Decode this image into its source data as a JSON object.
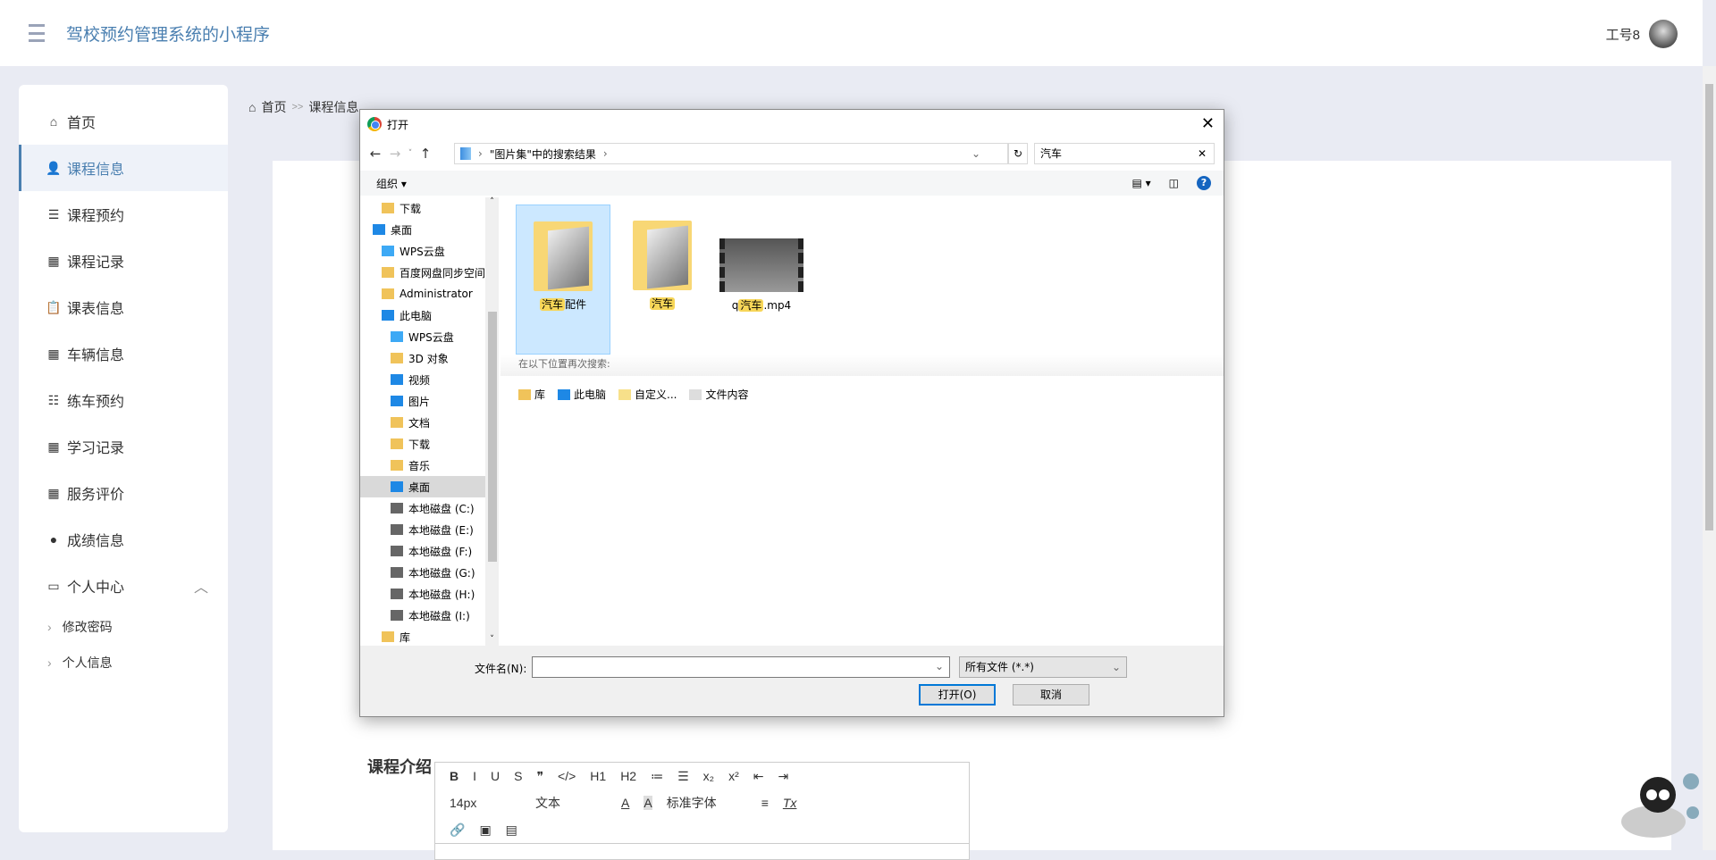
{
  "header": {
    "title": "驾校预约管理系统的小程序",
    "user": "工号8"
  },
  "sidebar": {
    "items": [
      {
        "label": "首页",
        "icon": "home-icon",
        "glyph": "⌂"
      },
      {
        "label": "课程信息",
        "icon": "user-icon",
        "glyph": "👤"
      },
      {
        "label": "课程预约",
        "icon": "list-icon",
        "glyph": "☰"
      },
      {
        "label": "课程记录",
        "icon": "grid-icon",
        "glyph": "▦"
      },
      {
        "label": "课表信息",
        "icon": "clipboard-icon",
        "glyph": "📋"
      },
      {
        "label": "车辆信息",
        "icon": "grid-icon",
        "glyph": "▦"
      },
      {
        "label": "练车预约",
        "icon": "sliders-icon",
        "glyph": "☷"
      },
      {
        "label": "学习记录",
        "icon": "grid-icon",
        "glyph": "▦"
      },
      {
        "label": "服务评价",
        "icon": "grid-icon",
        "glyph": "▦"
      },
      {
        "label": "成绩信息",
        "icon": "bulb-icon",
        "glyph": "●"
      },
      {
        "label": "个人中心",
        "icon": "card-icon",
        "glyph": "▭"
      }
    ],
    "sub": [
      {
        "label": "修改密码"
      },
      {
        "label": "个人信息"
      }
    ]
  },
  "breadcrumb": {
    "home": "首页",
    "sep": ">>",
    "current": "课程信息"
  },
  "editor": {
    "label": "课程介绍",
    "toolbar1": [
      "B",
      "I",
      "U",
      "S",
      "❞",
      "</>",
      "H1",
      "H2",
      "≔",
      "☰",
      "x₂",
      "x²",
      "⇤",
      "⇥"
    ],
    "font_size": "14px",
    "text_type": "文本",
    "font_family": "标准字体"
  },
  "dialog": {
    "title": "打开",
    "path": "\"图片集\"中的搜索结果",
    "search": "汽车",
    "organize": "组织",
    "nav": [
      {
        "label": "下载",
        "indent": 2
      },
      {
        "label": "桌面",
        "indent": 1
      },
      {
        "label": "WPS云盘",
        "indent": 2
      },
      {
        "label": "百度网盘同步空间",
        "indent": 2
      },
      {
        "label": "Administrator",
        "indent": 2
      },
      {
        "label": "此电脑",
        "indent": 2
      },
      {
        "label": "WPS云盘",
        "indent": 3
      },
      {
        "label": "3D 对象",
        "indent": 3
      },
      {
        "label": "视频",
        "indent": 3
      },
      {
        "label": "图片",
        "indent": 3
      },
      {
        "label": "文档",
        "indent": 3
      },
      {
        "label": "下载",
        "indent": 3
      },
      {
        "label": "音乐",
        "indent": 3
      },
      {
        "label": "桌面",
        "indent": 3,
        "selected": true
      },
      {
        "label": "本地磁盘 (C:)",
        "indent": 3
      },
      {
        "label": "本地磁盘 (E:)",
        "indent": 3
      },
      {
        "label": "本地磁盘 (F:)",
        "indent": 3
      },
      {
        "label": "本地磁盘 (G:)",
        "indent": 3
      },
      {
        "label": "本地磁盘 (H:)",
        "indent": 3
      },
      {
        "label": "本地磁盘 (I:)",
        "indent": 3
      },
      {
        "label": "库",
        "indent": 2
      }
    ],
    "files": [
      {
        "highlight": "汽车",
        "rest": "配件",
        "type": "folder",
        "selected": true
      },
      {
        "highlight": "汽车",
        "rest": "",
        "type": "folder"
      },
      {
        "prefix": "q",
        "highlight": "汽车",
        "rest": ".mp4",
        "type": "video"
      }
    ],
    "search_again_label": "在以下位置再次搜索:",
    "search_again": [
      "库",
      "此电脑",
      "自定义...",
      "文件内容"
    ],
    "filename_label": "文件名(N):",
    "filename": "",
    "filetype": "所有文件 (*.*)",
    "open": "打开(O)",
    "cancel": "取消"
  }
}
